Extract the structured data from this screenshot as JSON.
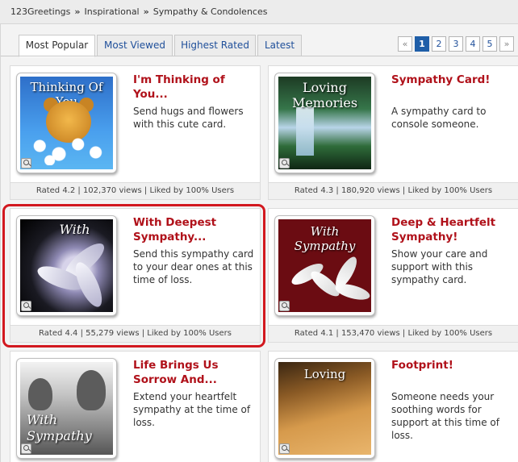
{
  "breadcrumb": {
    "items": [
      "123Greetings",
      "Inspirational",
      "Sympathy & Condolences"
    ],
    "separator": "»"
  },
  "tabs": [
    {
      "label": "Most Popular",
      "active": true
    },
    {
      "label": "Most Viewed",
      "active": false
    },
    {
      "label": "Highest Rated",
      "active": false
    },
    {
      "label": "Latest",
      "active": false
    }
  ],
  "pager": {
    "prev": "«",
    "next": "»",
    "pages": [
      "1",
      "2",
      "3",
      "4",
      "5"
    ],
    "current": "1"
  },
  "cards": [
    {
      "title": "I'm Thinking of You...",
      "description": "Send hugs and flowers with this cute card.",
      "thumbnail_caption": "Thinking Of You",
      "footer": "Rated 4.2 | 102,370 views | Liked by 100% Users"
    },
    {
      "title": "Sympathy Card!",
      "description": "A sympathy card to console someone.",
      "thumbnail_caption": "Loving Memories",
      "footer": "Rated 4.3 | 180,920 views | Liked by 100% Users"
    },
    {
      "title": "With Deepest Sympathy...",
      "description": "Send this sympathy card to your dear ones at this time of loss.",
      "thumbnail_caption": "With",
      "footer": "Rated 4.4 | 55,279 views | Liked by 100% Users"
    },
    {
      "title": "Deep & Heartfelt Sympathy!",
      "description": "Show your care and support with this sympathy card.",
      "thumbnail_caption": "With Sympathy",
      "footer": "Rated 4.1 | 153,470 views | Liked by 100% Users"
    },
    {
      "title": "Life Brings Us Sorrow And...",
      "description": "Extend your heartfelt sympathy at the time of loss.",
      "thumbnail_caption": "With Sympathy",
      "footer": ""
    },
    {
      "title": "Footprint!",
      "description": "Someone needs your soothing words for support at this time of loss.",
      "thumbnail_caption": "Loving",
      "footer": ""
    }
  ],
  "colors": {
    "title_red": "#b0111a",
    "link_blue": "#1f4f9a",
    "highlight_red": "#d2181f",
    "pager_active": "#1f5ea8"
  }
}
